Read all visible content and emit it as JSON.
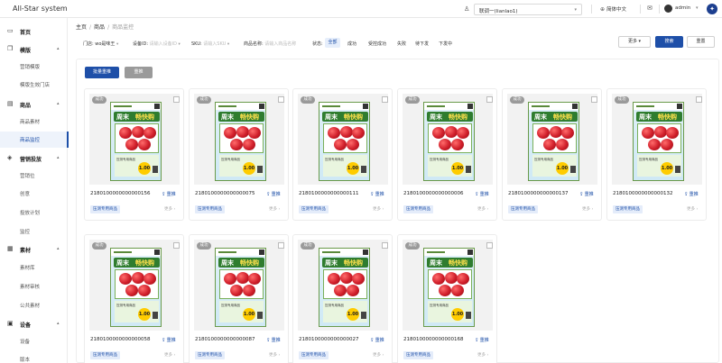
{
  "app": {
    "title": "All-Star system"
  },
  "topbar": {
    "store": "联调一(lianlao1)",
    "language": "简体中文",
    "user": "admin"
  },
  "sidebar": {
    "groups": [
      {
        "label": "首页",
        "icon": "monitor-icon"
      },
      {
        "label": "模版",
        "icon": "template-icon",
        "items": [
          "营销模版",
          "模版生效门店"
        ]
      },
      {
        "label": "商品",
        "icon": "bag-icon",
        "items": [
          "商品素材",
          "商品监控"
        ]
      },
      {
        "label": "营销投放",
        "icon": "launch-icon",
        "items": [
          "营销位",
          "创意",
          "投放计划",
          "监控"
        ]
      },
      {
        "label": "素材",
        "icon": "media-icon",
        "items": [
          "素材库",
          "素材审核",
          "公共素材"
        ]
      },
      {
        "label": "设备",
        "icon": "device-icon",
        "items": [
          "设备",
          "版本"
        ]
      }
    ],
    "active_item": "商品监控"
  },
  "breadcrumb": {
    "home": "主页",
    "section": "商品",
    "current": "商品监控"
  },
  "filters": {
    "store_label": "门店:",
    "store_value": "wo是味王",
    "device_label": "设备ID:",
    "device_placeholder": "请输入设备ID",
    "sku_label": "SKU:",
    "sku_placeholder": "请输入SKU",
    "name_label": "商品名称:",
    "name_placeholder": "请输入商品名称",
    "status_label": "状态:",
    "status_options": [
      "全部",
      "成功",
      "受控成功",
      "失败",
      "待下发",
      "下发中"
    ],
    "status_selected": "全部",
    "more": "更多",
    "search": "搜索",
    "reset": "重置"
  },
  "actions": {
    "batch_retry": "批量重推",
    "retry": "重推"
  },
  "card_texts": {
    "status": "成功",
    "tag": "压测专用商品",
    "bind": "重推",
    "more": "更多",
    "poster_title_a": "周末",
    "poster_title_b": "畅快购",
    "poster_note": "压测专用商品",
    "poster_price": "1.00"
  },
  "products": [
    {
      "code": "2180100000000000156"
    },
    {
      "code": "2180100000000000075"
    },
    {
      "code": "2180100000000000111"
    },
    {
      "code": "2180100000000000006"
    },
    {
      "code": "2180100000000000137"
    },
    {
      "code": "2180100000000000132"
    },
    {
      "code": "2180100000000000058"
    },
    {
      "code": "2180100000000000087"
    },
    {
      "code": "2180100000000000027"
    },
    {
      "code": "2180100000000000168"
    }
  ]
}
